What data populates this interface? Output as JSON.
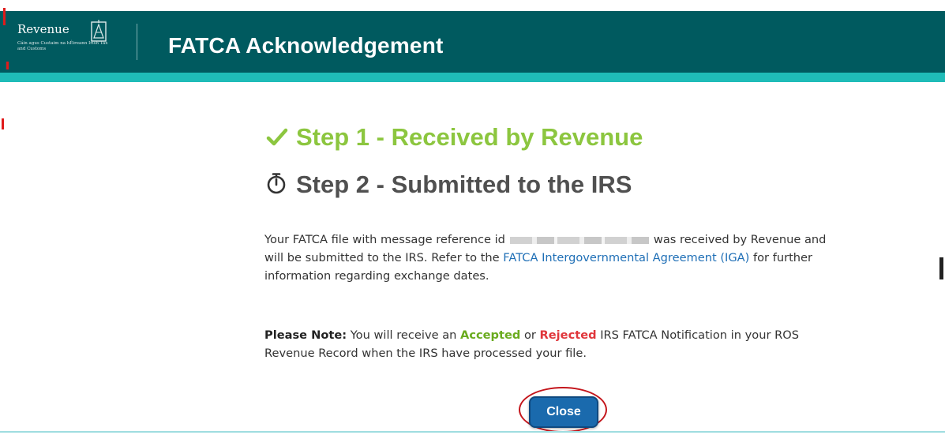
{
  "header": {
    "logo_name": "Revenue",
    "logo_subtitle": "Cáin agus Custaim na hÉireann Irish Tax and Customs",
    "title": "FATCA Acknowledgement"
  },
  "steps": [
    {
      "label": "Step 1 - Received by Revenue",
      "icon": "check-icon",
      "color": "#8cc63f"
    },
    {
      "label": "Step 2 - Submitted to the IRS",
      "icon": "stopwatch-icon",
      "color": "#505050"
    }
  ],
  "message": {
    "prefix": "Your FATCA file with message reference id",
    "suffix": "was received by Revenue and will be submitted to the IRS. Refer to the",
    "link": "FATCA Intergovernmental Agreement (IGA)",
    "tail": "for further information regarding exchange dates."
  },
  "note": {
    "label": "Please Note:",
    "text1": "You will receive an",
    "accepted": "Accepted",
    "or": "or",
    "rejected": "Rejected",
    "text2": "IRS FATCA Notification in your ROS Revenue Record when the IRS have processed your file."
  },
  "close_button": {
    "label": "Close"
  },
  "colors": {
    "header_bg": "#005a5f",
    "header_stripe": "#1fbcb8",
    "accepted": "#6aab1e",
    "rejected": "#e0363b",
    "link": "#1f6fb6",
    "button": "#1a6aad"
  }
}
